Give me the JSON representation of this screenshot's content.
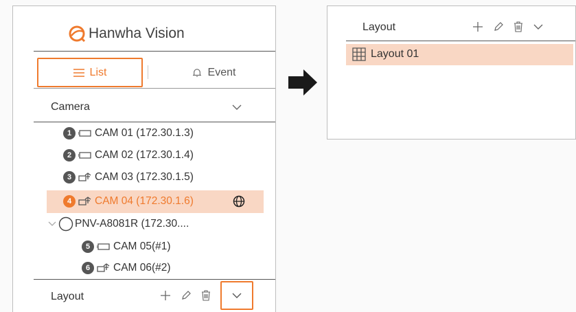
{
  "left_panel": {
    "brand": "Hanwha Vision",
    "tabs": [
      {
        "label": "List",
        "icon": "list-icon",
        "active": true
      },
      {
        "label": "Event",
        "icon": "bell-icon",
        "active": false
      }
    ],
    "camera_header": "Camera",
    "cameras": [
      {
        "badge": "1",
        "icon": "box-camera-icon",
        "label": "CAM 01 (172.30.1.3)"
      },
      {
        "badge": "2",
        "icon": "box-camera-icon",
        "label": "CAM 02 (172.30.1.4)"
      },
      {
        "badge": "3",
        "icon": "ptz-camera-icon",
        "label": "CAM 03 (172.30.1.5)"
      },
      {
        "badge": "4",
        "icon": "ptz-camera-icon",
        "label": "CAM 04 (172.30.1.6)",
        "selected": true
      }
    ],
    "group": {
      "label": "PNV-A8081R (172.30....",
      "icon": "multi-sensor-icon"
    },
    "sub_cameras": [
      {
        "badge": "5",
        "icon": "box-camera-icon",
        "label": "CAM 05(#1)"
      },
      {
        "badge": "6",
        "icon": "ptz-camera-icon",
        "label": "CAM 06(#2)"
      }
    ],
    "layout_header": "Layout"
  },
  "right_panel": {
    "layout_header": "Layout",
    "layouts": [
      {
        "icon": "grid-icon",
        "label": "Layout 01",
        "selected": true
      }
    ]
  },
  "colors": {
    "accent": "#ef7a2d",
    "selection_bg": "#f9d7c4",
    "text": "#333333"
  }
}
